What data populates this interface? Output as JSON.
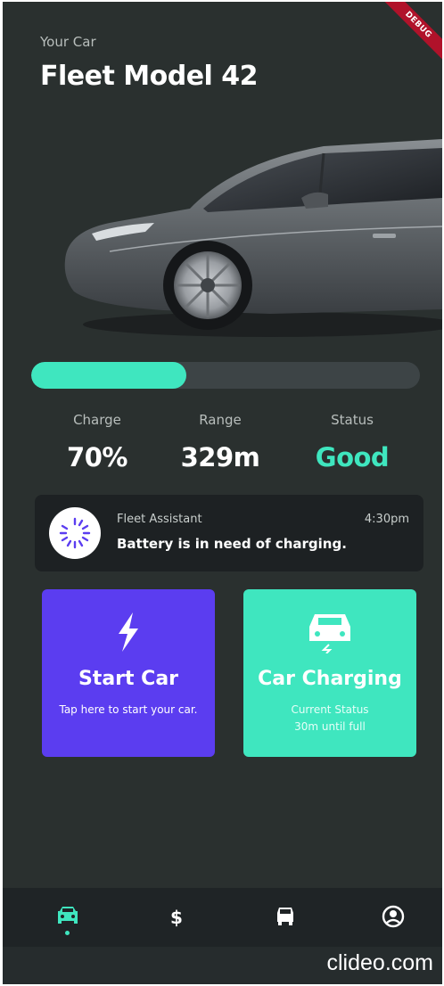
{
  "header": {
    "subtitle": "Your Car",
    "title": "Fleet Model 42",
    "debug_badge": "DEBUG"
  },
  "charge_progress": 0.4,
  "stats": [
    {
      "label": "Charge",
      "value": "70%"
    },
    {
      "label": "Range",
      "value": "329m"
    },
    {
      "label": "Status",
      "value": "Good"
    }
  ],
  "notification": {
    "sender": "Fleet Assistant",
    "time": "4:30pm",
    "message": "Battery is in need of charging.",
    "icon": "spinner-icon"
  },
  "cards": {
    "start": {
      "title": "Start Car",
      "description": "Tap here to start your car.",
      "icon": "lightning-bolt-icon"
    },
    "charging": {
      "title": "Car Charging",
      "description_line1": "Current Status",
      "description_line2": "30m until full",
      "icon": "car-charging-icon"
    }
  },
  "nav": {
    "items": [
      {
        "icon": "car-icon",
        "active": true
      },
      {
        "icon": "dollar-icon",
        "active": false
      },
      {
        "icon": "car-front-icon",
        "active": false
      },
      {
        "icon": "profile-icon",
        "active": false
      }
    ]
  },
  "watermark": "clideo.com",
  "colors": {
    "background": "#2a302f",
    "accent": "#3fe6bf",
    "start_card": "#5b3df0",
    "nav_bg": "#1f2426"
  }
}
